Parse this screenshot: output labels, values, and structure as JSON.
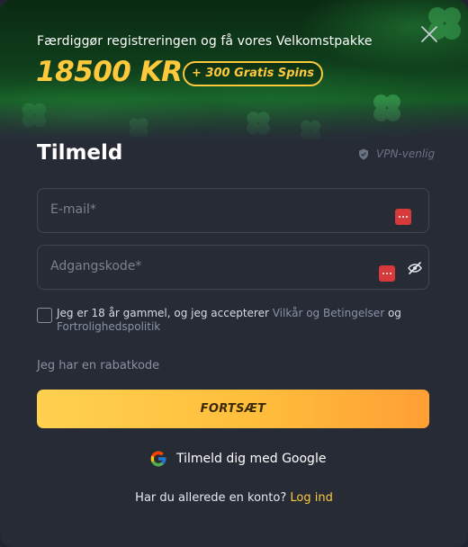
{
  "banner": {
    "subtitle": "Færdiggør registreringen og få vores Velkomstpakke",
    "amount": "18500 KR",
    "badge": "+ 300 Gratis Spins"
  },
  "form": {
    "title": "Tilmeld",
    "vpn_label": "VPN-venlig",
    "email_placeholder": "E-mail*",
    "password_placeholder": "Adgangskode*",
    "terms_prefix": "Jeg er 18 år gammel, og jeg accepterer ",
    "terms_link": "Vilkår og Betingelser",
    "terms_and": " og ",
    "privacy_link": "Fortrolighedspolitik",
    "promo_code_label": "Jeg har en rabatkode",
    "submit_label": "FORTSÆT",
    "google_label": "Tilmeld dig med Google",
    "login_prompt": "Har du allerede en konto? ",
    "login_link": "Log ind"
  },
  "colors": {
    "accent": "#ffc93c",
    "background": "#262b36",
    "danger_icon": "#d63a3a"
  },
  "icons": [
    "close-icon",
    "shield-icon",
    "password-manager-icon",
    "eye-hidden-icon",
    "google-icon"
  ]
}
